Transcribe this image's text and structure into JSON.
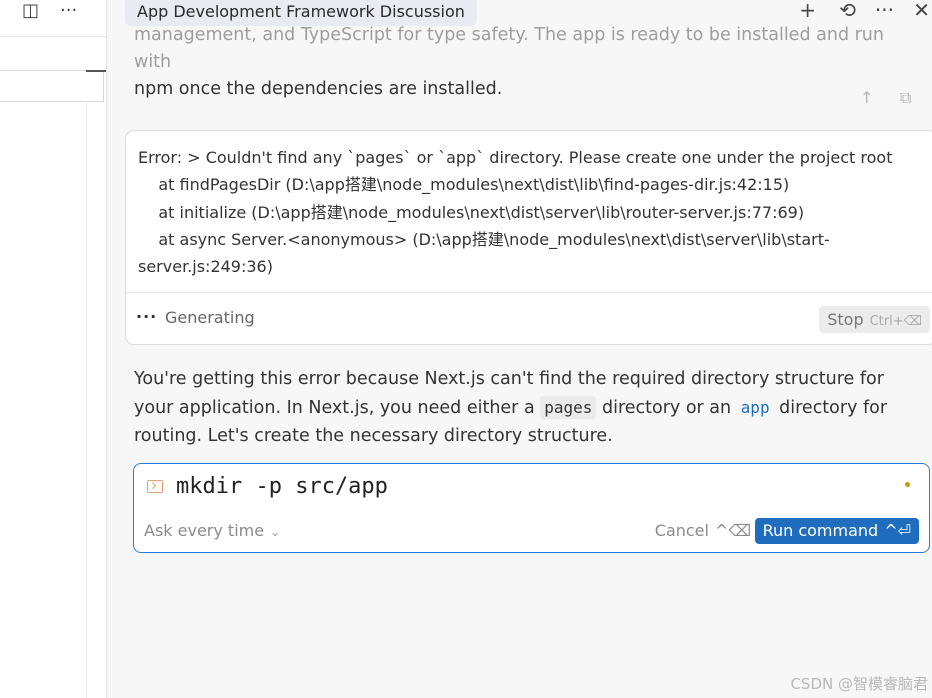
{
  "left_pane": {
    "toolbar_icons": [
      "panel-layout-icon",
      "more-horizontal-icon"
    ],
    "layout_glyph": "◫",
    "more_glyph": "···"
  },
  "header": {
    "title": "App Development Framework Discussion",
    "icons": [
      "plus-icon",
      "history-icon",
      "more-horizontal-icon",
      "close-icon"
    ],
    "plus_glyph": "+",
    "history_glyph": "⟲",
    "more_glyph": "···",
    "close_glyph": "✕"
  },
  "previous_message": {
    "clipped_line": "management, and TypeScript for type safety. The app is ready to be installed and run with",
    "line2": "npm once the dependencies are installed.",
    "actions": [
      "arrow-up-icon",
      "copy-icon"
    ],
    "up_glyph": "↑",
    "copy_glyph": "⧉"
  },
  "error_block": {
    "text": "Error: > Couldn't find any `pages` or `app` directory. Please create one under the project root\n    at findPagesDir (D:\\app搭建\\node_modules\\next\\dist\\lib\\find-pages-dir.js:42:15)\n    at initialize (D:\\app搭建\\node_modules\\next\\dist\\server\\lib\\router-server.js:77:69)\n    at async Server.<anonymous> (D:\\app搭建\\node_modules\\next\\dist\\server\\lib\\start-server.js:249:36)",
    "status_dots": "···",
    "status_label": "Generating",
    "stop_label": "Stop",
    "stop_shortcut": "Ctrl+⌫"
  },
  "reply": {
    "part1": "You're getting this error because Next.js can't find the required directory structure for your application. In Next.js, you need either a ",
    "code1": "pages",
    "part2": " directory or an ",
    "code2": "app",
    "part3": " directory for routing. Let's create the necessary directory structure."
  },
  "command": {
    "text": "mkdir -p src/app",
    "ask_label": "Ask every time",
    "ask_chevron": "⌄",
    "cancel_label": "Cancel",
    "cancel_shortcut": "^⌫",
    "run_label": "Run command",
    "run_shortcut": "^⏎"
  },
  "watermark": "CSDN @智模睿脑君",
  "colors": {
    "accent": "#1f6dbf",
    "command_border": "#2f7ad8",
    "status_dot": "#c3a000",
    "terminal_icon": "#e8a070"
  }
}
